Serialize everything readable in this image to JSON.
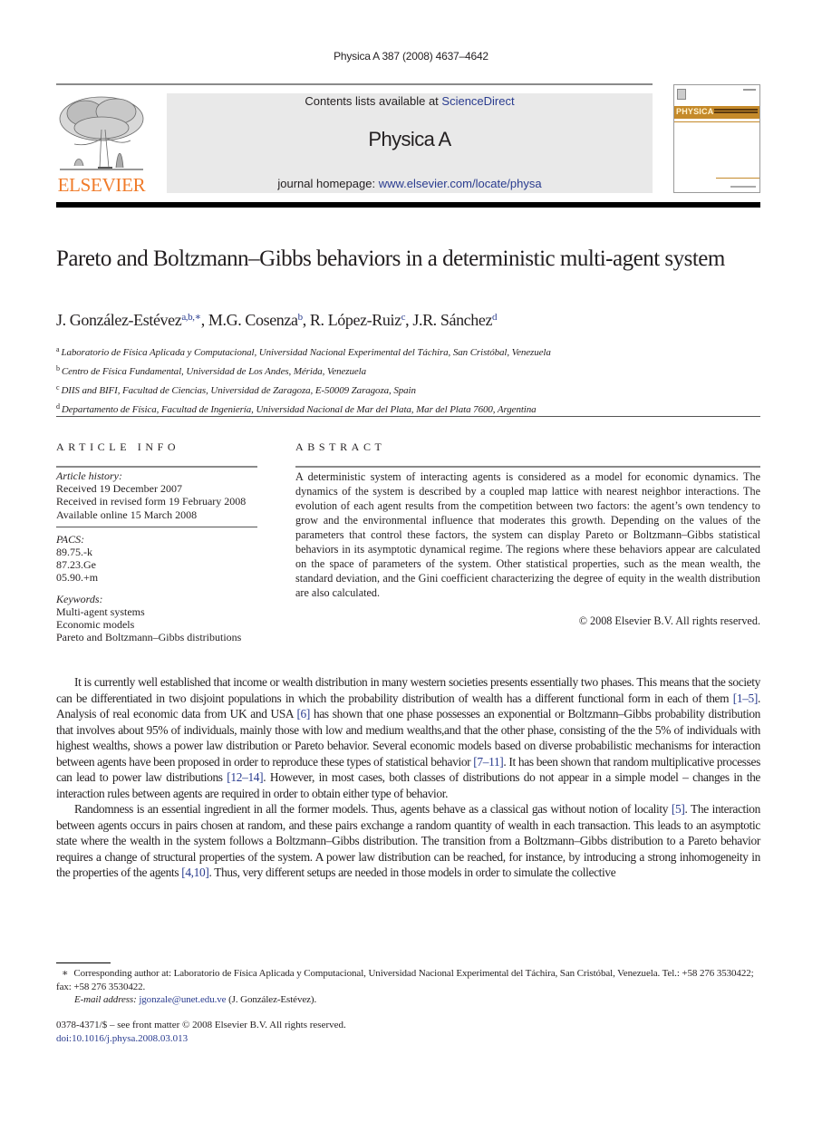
{
  "running_head": "Physica A 387 (2008) 4637–4642",
  "publisher": {
    "name": "ELSEVIER",
    "brand_color": "#f07b2a"
  },
  "banner": {
    "contents_prefix": "Contents lists available at ",
    "contents_link": "ScienceDirect",
    "journal_name": "Physica A",
    "homepage_prefix": "journal homepage: ",
    "homepage_link": "www.elsevier.com/locate/physa",
    "link_color": "#2a3c8f"
  },
  "cover_thumbnail": {
    "title": "PHYSICA",
    "accent_color": "#c58a2a"
  },
  "article": {
    "title": "Pareto and Boltzmann–Gibbs behaviors in a deterministic multi-agent system",
    "authors": [
      {
        "name": "J. González-Estévez",
        "sup": "a,b,∗",
        "sep": ", "
      },
      {
        "name": "M.G. Cosenza",
        "sup": "b",
        "sep": ", "
      },
      {
        "name": "R. López-Ruiz",
        "sup": "c",
        "sep": ", "
      },
      {
        "name": "J.R. Sánchez",
        "sup": "d",
        "sep": ""
      }
    ],
    "affiliations": [
      {
        "mark": "a",
        "text": "Laboratorio de Física Aplicada y Computacional, Universidad Nacional Experimental del Táchira, San Cristóbal, Venezuela"
      },
      {
        "mark": "b",
        "text": "Centro de Física Fundamental, Universidad de Los Andes, Mérida, Venezuela"
      },
      {
        "mark": "c",
        "text": "DIIS and BIFI, Facultad de Ciencias, Universidad de Zaragoza, E-50009 Zaragoza, Spain"
      },
      {
        "mark": "d",
        "text": "Departamento de Física, Facultad de Ingeniería, Universidad Nacional de Mar del Plata, Mar del Plata 7600, Argentina"
      }
    ]
  },
  "article_info": {
    "heading": "ARTICLE INFO",
    "history_label": "Article history:",
    "history": [
      "Received 19 December 2007",
      "Received in revised form 19 February 2008",
      "Available online 15 March 2008"
    ],
    "pacs_label": "PACS:",
    "pacs": [
      "89.75.-k",
      "87.23.Ge",
      "05.90.+m"
    ],
    "keywords_label": "Keywords:",
    "keywords": [
      "Multi-agent systems",
      "Economic models",
      "Pareto and Boltzmann–Gibbs distributions"
    ]
  },
  "abstract": {
    "heading": "ABSTRACT",
    "text": "A deterministic system of interacting agents is considered as a model for economic dynamics. The dynamics of the system is described by a coupled map lattice with nearest neighbor interactions. The evolution of each agent results from the competition between two factors: the agent’s own tendency to grow and the environmental influence that moderates this growth. Depending on the values of the parameters that control these factors, the system can display Pareto or Boltzmann–Gibbs statistical behaviors in its asymptotic dynamical regime. The regions where these behaviors appear are calculated on the space of parameters of the system. Other statistical properties, such as the mean wealth, the standard deviation, and the Gini coefficient characterizing the degree of equity in the wealth distribution are also calculated.",
    "copyright": "© 2008 Elsevier B.V. All rights reserved."
  },
  "body": {
    "paragraphs": [
      [
        {
          "t": "It is currently well established that income or wealth distribution in many western societies presents essentially two phases. This means that the society can be differentiated in two disjoint populations in which the probability distribution of wealth has a different functional form in each of them "
        },
        {
          "ref": "[1–5]"
        },
        {
          "t": ". Analysis of real economic data from UK and USA "
        },
        {
          "ref": "[6]"
        },
        {
          "t": " has shown that one phase possesses an exponential or Boltzmann–Gibbs probability distribution that involves about 95% of individuals, mainly those with low and medium wealths,and that the other phase, consisting of the the 5% of individuals with highest wealths, shows a power law distribution or Pareto behavior. Several economic models based on diverse probabilistic mechanisms for interaction between agents have been proposed in order to reproduce these types of statistical behavior "
        },
        {
          "ref": "[7–11]"
        },
        {
          "t": ". It has been shown that random multiplicative processes can lead to power law distributions "
        },
        {
          "ref": "[12–14]"
        },
        {
          "t": ". However, in most cases, both classes of distributions do not appear in a simple model – changes in the interaction rules between agents are required in order to obtain either type of behavior."
        }
      ],
      [
        {
          "t": "Randomness is an essential ingredient in all the former models. Thus, agents behave as a classical gas without notion of locality "
        },
        {
          "ref": "[5]"
        },
        {
          "t": ". The interaction between agents occurs in pairs chosen at random, and these pairs exchange a random quantity of wealth in each transaction. This leads to an asymptotic state where the wealth in the system follows a Boltzmann–Gibbs distribution. The transition from a Boltzmann–Gibbs distribution to a Pareto behavior requires a change of structural properties of the system. A power law distribution can be reached, for instance, by introducing a strong inhomogeneity in the properties of the agents "
        },
        {
          "ref": "[4,10]"
        },
        {
          "t": ". Thus, very different setups are needed in those models in order to simulate the collective"
        }
      ]
    ]
  },
  "footnotes": {
    "corresponding_mark": "∗",
    "corresponding_text": "Corresponding author at: Laboratorio de Física Aplicada y Computacional, Universidad Nacional Experimental del Táchira, San Cristóbal, Venezuela. Tel.: +58 276 3530422; fax: +58 276 3530422.",
    "email_label": "E-mail address:",
    "email": "jgonzale@unet.edu.ve",
    "email_owner": "(J. González-Estévez)."
  },
  "front_matter": {
    "issn_line": "0378-4371/$ – see front matter © 2008 Elsevier B.V. All rights reserved.",
    "doi": "doi:10.1016/j.physa.2008.03.013"
  }
}
